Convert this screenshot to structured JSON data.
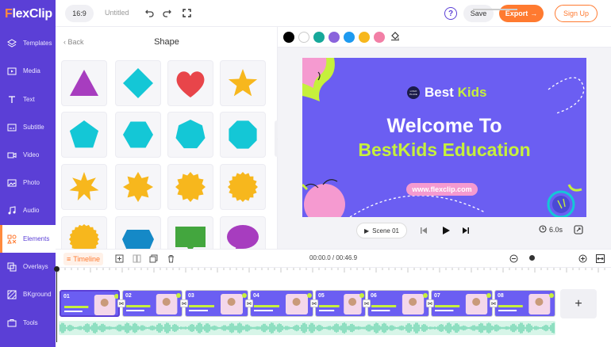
{
  "app": {
    "logo_first": "F",
    "logo_rest": "lexClip"
  },
  "sidebar": {
    "items": [
      {
        "label": "Templates",
        "icon": "layers-icon"
      },
      {
        "label": "Media",
        "icon": "media-icon"
      },
      {
        "label": "Text",
        "icon": "text-icon"
      },
      {
        "label": "Subtitle",
        "icon": "subtitle-icon"
      },
      {
        "label": "Video",
        "icon": "video-icon"
      },
      {
        "label": "Photo",
        "icon": "photo-icon"
      },
      {
        "label": "Audio",
        "icon": "music-icon"
      },
      {
        "label": "Elements",
        "icon": "elements-icon",
        "active": true
      },
      {
        "label": "Overlays",
        "icon": "overlays-icon"
      },
      {
        "label": "BKground",
        "icon": "background-icon"
      },
      {
        "label": "Tools",
        "icon": "tools-icon"
      }
    ]
  },
  "topbar": {
    "ratio": "16:9",
    "title": "Untitled",
    "save_label": "Save",
    "export_label": "Export",
    "signup_label": "Sign Up",
    "help_label": "?"
  },
  "panel": {
    "back_label": "Back",
    "title": "Shape",
    "shapes": [
      {
        "name": "triangle",
        "color": "#a73dbf"
      },
      {
        "name": "diamond",
        "color": "#14c7d6"
      },
      {
        "name": "heart",
        "color": "#e8454a"
      },
      {
        "name": "star",
        "color": "#f7b71d"
      },
      {
        "name": "pentagon",
        "color": "#14c7d6"
      },
      {
        "name": "hexagon",
        "color": "#14c7d6"
      },
      {
        "name": "heptagon",
        "color": "#14c7d6"
      },
      {
        "name": "octagon",
        "color": "#14c7d6"
      },
      {
        "name": "star-7",
        "color": "#f7b71d"
      },
      {
        "name": "star-8",
        "color": "#f7b71d"
      },
      {
        "name": "burst-12",
        "color": "#f7b71d"
      },
      {
        "name": "burst-16",
        "color": "#f7b71d"
      },
      {
        "name": "scallop",
        "color": "#f7b71d"
      },
      {
        "name": "hexagon-wide",
        "color": "#1589c7"
      },
      {
        "name": "speech-rect",
        "color": "#43a63e"
      },
      {
        "name": "speech-oval",
        "color": "#a73dbf"
      }
    ]
  },
  "colors": [
    "#000000",
    "#ffffff",
    "#16a89a",
    "#8a63dc",
    "#1e9af0",
    "#f7b71d",
    "#f27fa6"
  ],
  "canvas": {
    "logo_badge": "LOGO PLACE",
    "brand": "Best",
    "brand_accent": "Kids",
    "headline_1": "Welcome To",
    "headline_2": "BestKids Education",
    "url": "www.flexclip.com",
    "bg": "#6b5ef2",
    "accent": "#c6f03c"
  },
  "player": {
    "scene_label": "Scene 01",
    "duration": "6.0s"
  },
  "timeline": {
    "label": "Timeline",
    "time": "00:00.0 / 00:46.9",
    "clips": [
      "01",
      "02",
      "03",
      "04",
      "05",
      "06",
      "07",
      "08"
    ],
    "add_label": "+"
  }
}
